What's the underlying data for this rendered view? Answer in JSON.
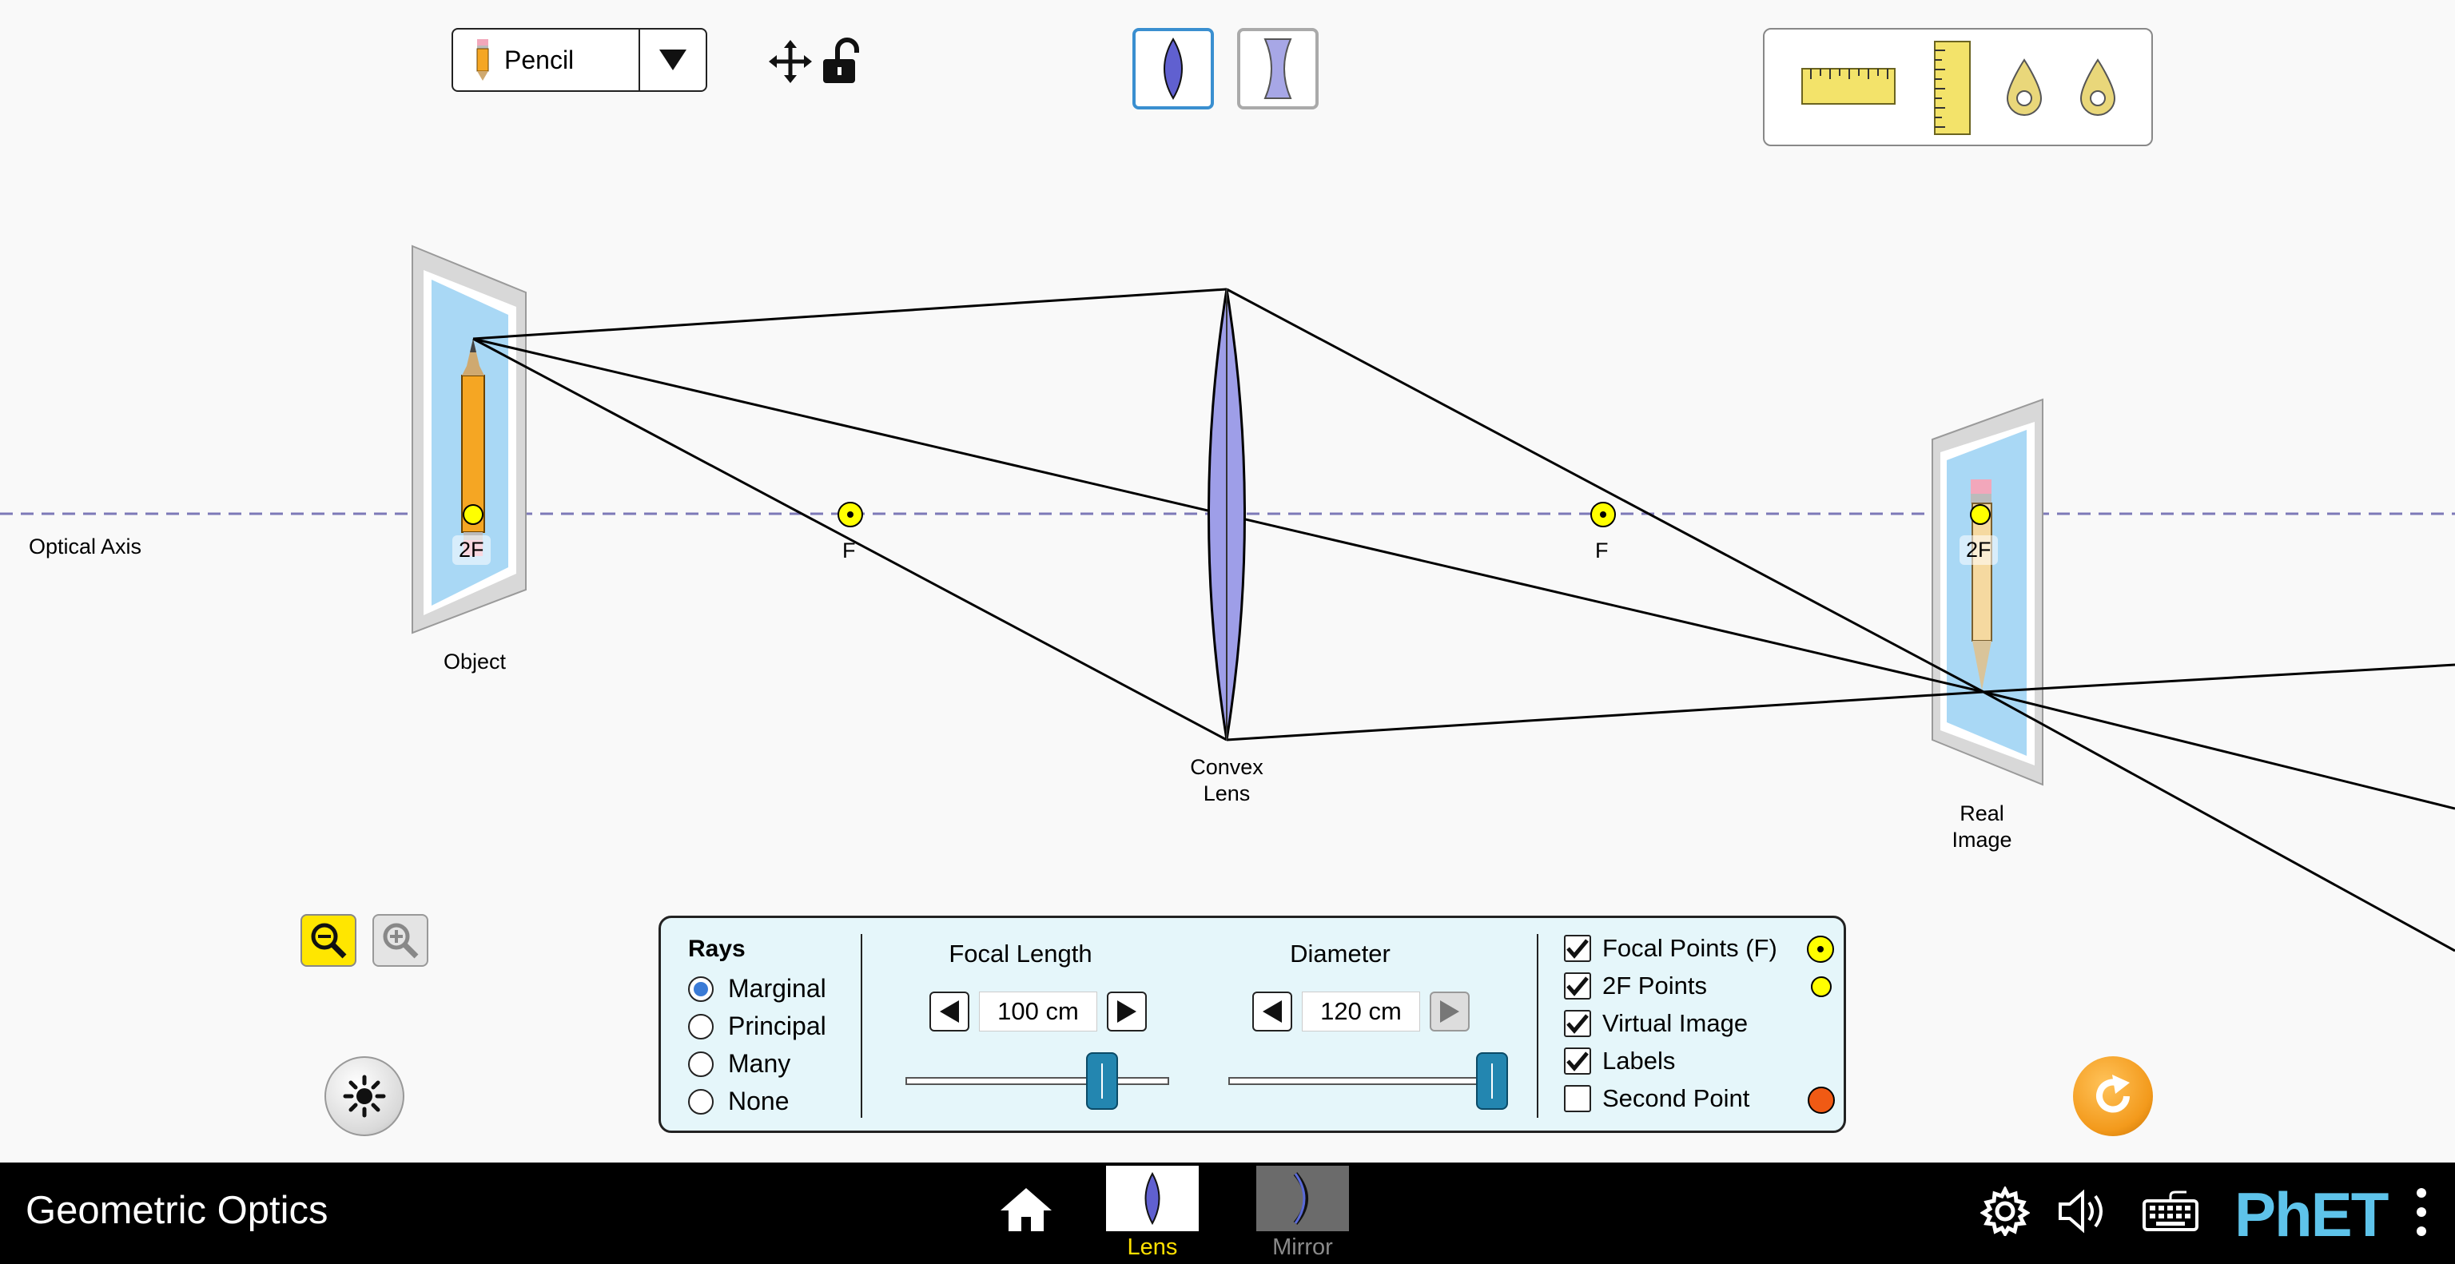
{
  "object_selector": {
    "label": "Pencil",
    "icon": "pencil-icon"
  },
  "top_tools": {
    "move_icon": "four-way-arrow-icon",
    "lock_icon": "unlocked-padlock-icon"
  },
  "lens_types": [
    {
      "name": "convex",
      "selected": true
    },
    {
      "name": "concave",
      "selected": false
    }
  ],
  "toolbox": [
    "horizontal-ruler-icon",
    "vertical-ruler-icon",
    "light-sensor-icon",
    "light-sensor-icon"
  ],
  "scene": {
    "optical_axis_label": "Optical Axis",
    "object_label": "Object",
    "lens_label_1": "Convex",
    "lens_label_2": "Lens",
    "image_label_1": "Real",
    "image_label_2": "Image",
    "focal_left": "F",
    "focal_right": "F",
    "twoF_left": "2F",
    "twoF_right": "2F"
  },
  "panel": {
    "rays_title": "Rays",
    "rays_options": [
      "Marginal",
      "Principal",
      "Many",
      "None"
    ],
    "rays_selected": "Marginal",
    "focal_length": {
      "title": "Focal Length",
      "value": "100 cm",
      "slider_fraction": 0.75
    },
    "diameter": {
      "title": "Diameter",
      "value": "120 cm",
      "slider_fraction": 1.0
    },
    "checkboxes": [
      {
        "label": "Focal Points (F)",
        "checked": true
      },
      {
        "label": "2F Points",
        "checked": true
      },
      {
        "label": "Virtual Image",
        "checked": true
      },
      {
        "label": "Labels",
        "checked": true
      },
      {
        "label": "Second Point",
        "checked": false
      }
    ]
  },
  "colors": {
    "lens": "#9e9ee8",
    "focal_point": "#ffff00",
    "panel": "#e5f6fa",
    "slider": "#2386b0",
    "reset": "#f39a1c",
    "second_point": "#f05a14",
    "selected_tab_label": "#ffe000"
  },
  "navbar": {
    "title": "Geometric Optics",
    "screens": [
      {
        "label": "Lens",
        "selected": true
      },
      {
        "label": "Mirror",
        "selected": false
      }
    ],
    "icons": [
      "home-icon",
      "settings-icon",
      "audio-icon",
      "keyboard-icon",
      "more-icon"
    ],
    "logo_text": "PhET"
  }
}
